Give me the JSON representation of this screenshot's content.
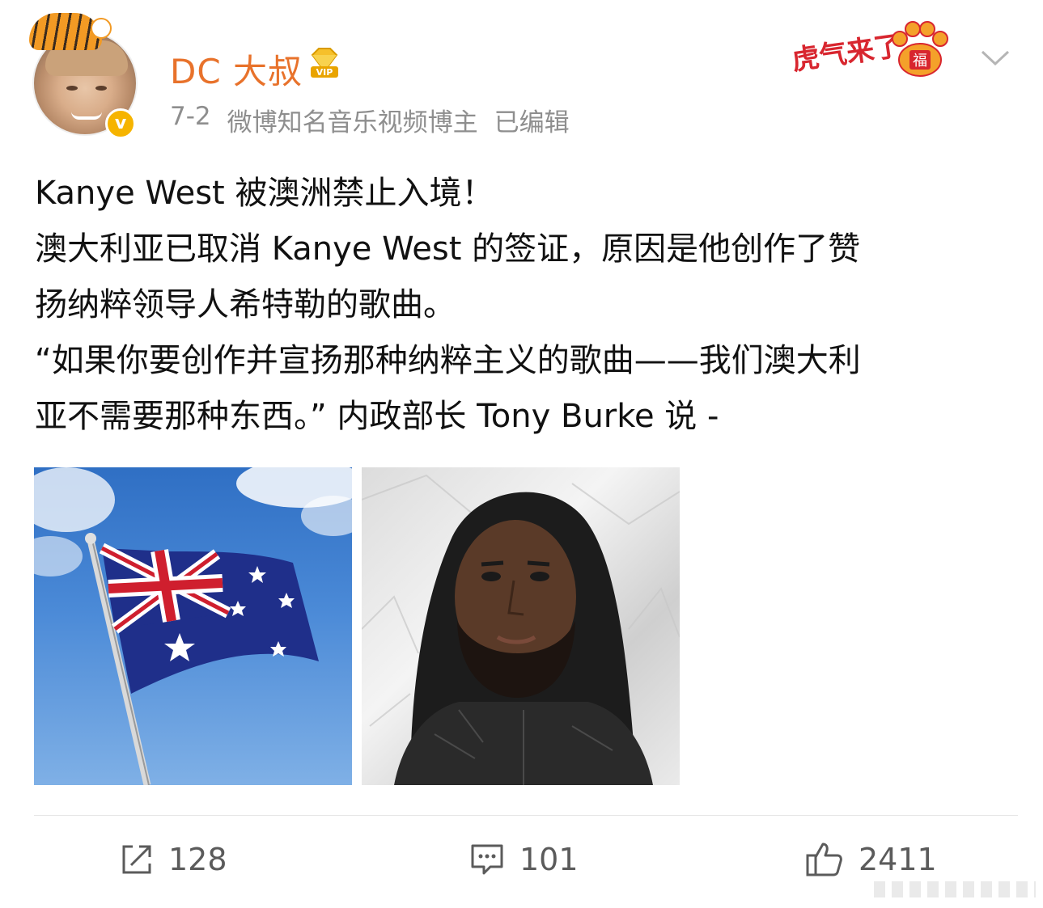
{
  "header": {
    "username": "DC 大叔",
    "date": "7-2",
    "role": "微博知名音乐视频博主",
    "edited": "已编辑",
    "verify_mark": "v",
    "festival_text": "虎气来了",
    "paw_char": "福"
  },
  "post": {
    "lines": [
      "Kanye West 被澳洲禁止入境！",
      "澳大利亚已取消 Kanye West 的签证，原因是他创作了赞",
      "扬纳粹领导人希特勒的歌曲。",
      "“如果你要创作并宣扬那种纳粹主义的歌曲——我们澳大利",
      "亚不需要那种东西。” 内政部长 Tony Burke 说 -"
    ]
  },
  "actions": {
    "share_count": "128",
    "comment_count": "101",
    "like_count": "2411"
  },
  "colors": {
    "username": "#e8722b",
    "meta": "#8e8e8e",
    "action": "#5b5b5b",
    "badge": "#f6b400"
  }
}
